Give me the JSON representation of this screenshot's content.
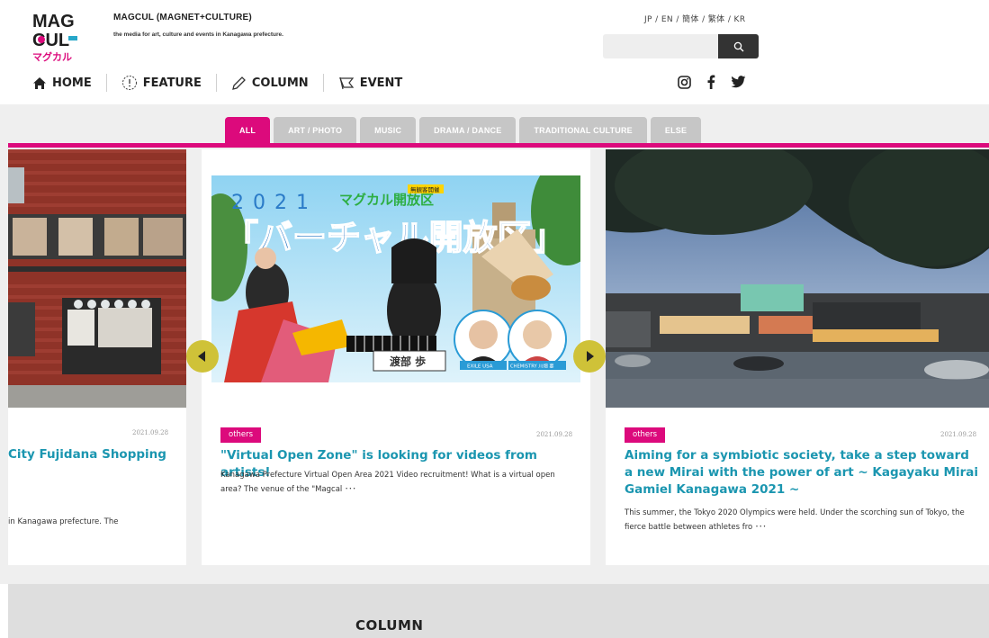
{
  "site": {
    "logo_text": [
      "MAG",
      "CUL",
      "マグカル"
    ],
    "title": "MAGCUL (MAGNET+CULTURE)",
    "subtitle": "the media for art, culture and events in Kanagawa prefecture."
  },
  "header": {
    "languages": "JP / EN / 簡体 / 繁体 / KR",
    "search": {
      "placeholder": "",
      "value": "",
      "button_icon": "search-icon"
    },
    "nav": [
      {
        "label": "HOME",
        "icon": "home-icon"
      },
      {
        "label": "FEATURE",
        "icon": "feature-icon"
      },
      {
        "label": "COLUMN",
        "icon": "pencil-icon"
      },
      {
        "label": "EVENT",
        "icon": "flag-icon"
      }
    ],
    "social": [
      "instagram-icon",
      "facebook-icon",
      "twitter-icon"
    ]
  },
  "tabs": [
    {
      "label": "ALL",
      "active": true
    },
    {
      "label": "ART / PHOTO",
      "active": false
    },
    {
      "label": "MUSIC",
      "active": false
    },
    {
      "label": "DRAMA / DANCE",
      "active": false
    },
    {
      "label": "TRADITIONAL CULTURE",
      "active": false
    },
    {
      "label": "ELSE",
      "active": false
    }
  ],
  "slides": {
    "left": {
      "date": "2021.09.28",
      "title": "City Fujidana Shopping",
      "desc": "in Kanagawa prefecture. The"
    },
    "center": {
      "tag": "others",
      "date": "2021.09.28",
      "title": "\"Virtual Open Zone\" is looking for videos from artists!",
      "desc": "Kanagawa Prefecture Virtual Open Area 2021 Video recruitment! What is a virtual open area? The venue of the \"Magcal ･･･",
      "image_text": {
        "year": "2021",
        "brand": "マグカル開放区",
        "big": "「バーチャル開放区」",
        "badge": "無観客開催",
        "name_box": "渡部 歩",
        "guest1": "EXILE USA",
        "guest2": "CHEMISTRY 川畑 要"
      }
    },
    "right": {
      "tag": "others",
      "date": "2021.09.28",
      "title": "Aiming for a symbiotic society, take a step toward a new Mirai with the power of art ~ Kagayaku Mirai Gamiel Kanagawa 2021 ~",
      "desc": "This summer, the Tokyo 2020 Olympics were held. Under the scorching sun of Tokyo, the fierce battle between athletes fro ･･･"
    }
  },
  "column_section": {
    "title": "COLUMN"
  },
  "colors": {
    "accent": "#dc0a7c",
    "link": "#1b96b0",
    "arrow": "#cfc238"
  }
}
